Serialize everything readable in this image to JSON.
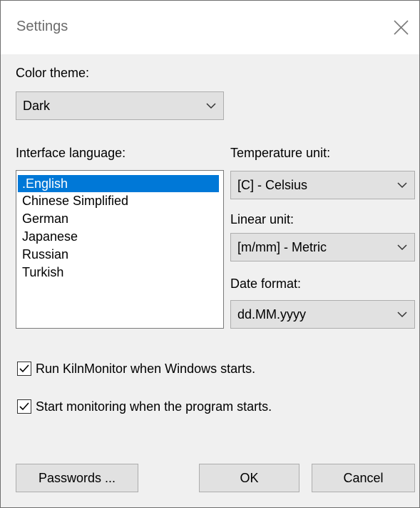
{
  "window": {
    "title": "Settings",
    "close_icon": "close-icon"
  },
  "color_theme": {
    "label": "Color theme:",
    "value": "Dark"
  },
  "interface_language": {
    "label": "Interface language:",
    "items": [
      ".English",
      "Chinese Simplified",
      "German",
      "Japanese",
      "Russian",
      "Turkish"
    ],
    "selected": ".English"
  },
  "temperature_unit": {
    "label": "Temperature unit:",
    "value": "[C] - Celsius"
  },
  "linear_unit": {
    "label": "Linear unit:",
    "value": "[m/mm] - Metric"
  },
  "date_format": {
    "label": "Date format:",
    "value": "dd.MM.yyyy"
  },
  "options": {
    "run_on_startup": {
      "label": "Run KilnMonitor when Windows starts.",
      "checked": true
    },
    "start_monitoring": {
      "label": "Start monitoring when the program starts.",
      "checked": true
    }
  },
  "buttons": {
    "passwords": "Passwords ...",
    "ok": "OK",
    "cancel": "Cancel"
  },
  "colors": {
    "selection": "#0078d7",
    "dialog_bg": "#f0f0f0",
    "control_bg": "#e1e1e1"
  }
}
